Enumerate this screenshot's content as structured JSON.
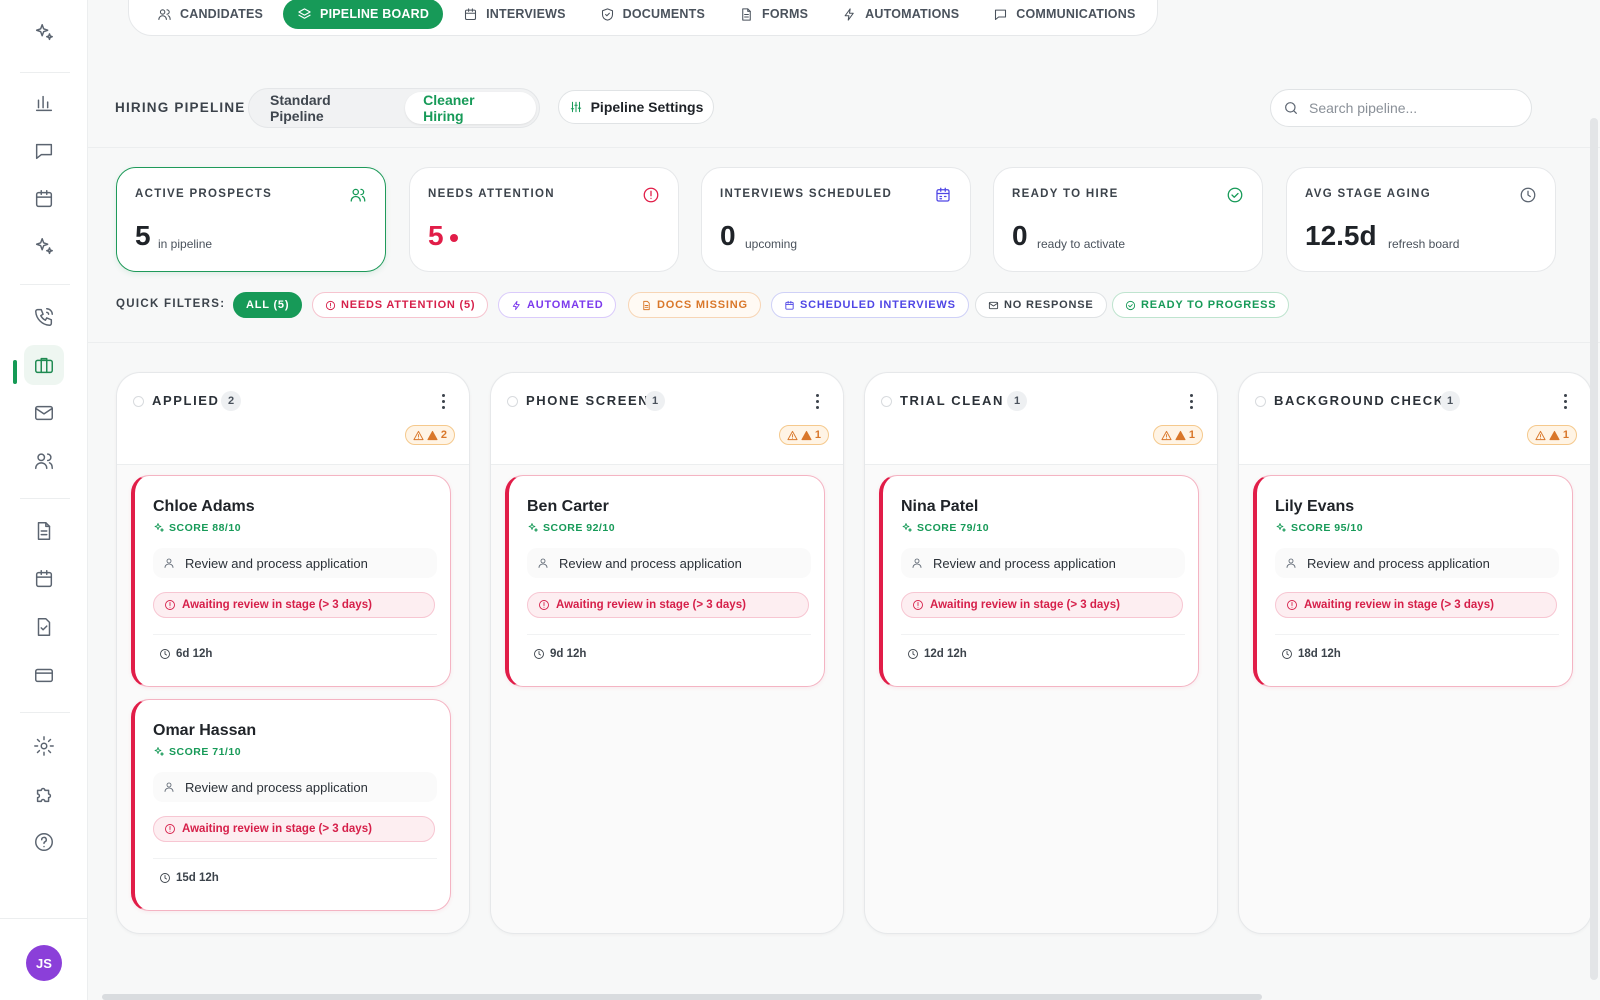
{
  "topnav": {
    "tabs": [
      {
        "label": "CANDIDATES",
        "icon": "users-icon"
      },
      {
        "label": "PIPELINE BOARD",
        "icon": "layers-icon",
        "active": true
      },
      {
        "label": "INTERVIEWS",
        "icon": "calendar-icon"
      },
      {
        "label": "DOCUMENTS",
        "icon": "shield-icon"
      },
      {
        "label": "FORMS",
        "icon": "file-icon"
      },
      {
        "label": "AUTOMATIONS",
        "icon": "bolt-icon"
      },
      {
        "label": "COMMUNICATIONS",
        "icon": "message-icon"
      }
    ]
  },
  "sidebar": {
    "icons": [
      "sparkle-icon",
      "bar-chart-icon",
      "message-icon",
      "calendar-icon",
      "sparkle-icon",
      "phone-icon",
      "briefcase-icon",
      "mail-icon",
      "users-icon",
      "document-icon",
      "calendar-icon",
      "clipboard-check-icon",
      "credit-card-icon",
      "gear-icon",
      "puzzle-icon",
      "help-icon"
    ],
    "active_icon": "briefcase-icon",
    "avatar_initials": "JS"
  },
  "header": {
    "label": "HIRING PIPELINE",
    "segments": [
      "Standard Pipeline",
      "Cleaner Hiring"
    ],
    "active_segment": "Cleaner Hiring",
    "settings_label": "Pipeline Settings",
    "search_placeholder": "Search pipeline..."
  },
  "stats": [
    {
      "label": "ACTIVE PROSPECTS",
      "value": "5",
      "sub": "in pipeline",
      "icon": "users-icon",
      "icon_color": "#179a58"
    },
    {
      "label": "NEEDS ATTENTION",
      "value": "5",
      "sub": "",
      "icon": "alert-circle-icon",
      "icon_color": "#e11d48"
    },
    {
      "label": "INTERVIEWS SCHEDULED",
      "value": "0",
      "sub": "upcoming",
      "icon": "calendar-icon",
      "icon_color": "#4f46e5"
    },
    {
      "label": "READY TO HIRE",
      "value": "0",
      "sub": "ready to activate",
      "icon": "check-circle-icon",
      "icon_color": "#179a58"
    },
    {
      "label": "AVG STAGE AGING",
      "value": "12.5d",
      "sub": "refresh board",
      "icon": "clock-icon",
      "icon_color": "#5b6470"
    }
  ],
  "quick_filters": {
    "label": "QUICK FILTERS:",
    "chips": [
      {
        "label": "ALL (5)",
        "style": "all"
      },
      {
        "label": "NEEDS ATTENTION (5)",
        "style": "red",
        "icon": "alert-circle-icon"
      },
      {
        "label": "AUTOMATED",
        "style": "purple",
        "icon": "bolt-icon"
      },
      {
        "label": "DOCS MISSING",
        "style": "orange",
        "icon": "file-icon"
      },
      {
        "label": "SCHEDULED INTERVIEWS",
        "style": "indigo",
        "icon": "calendar-icon"
      },
      {
        "label": "NO RESPONSE",
        "style": "gray",
        "icon": "mail-icon"
      },
      {
        "label": "READY TO PROGRESS",
        "style": "green",
        "icon": "check-circle-icon"
      }
    ]
  },
  "columns": [
    {
      "title": "APPLIED",
      "count": "2",
      "warning": "2",
      "cards": [
        {
          "name": "Chloe Adams",
          "score": "SCORE 88/10",
          "task": "Review and process application",
          "alert": "Awaiting review in stage (> 3 days)",
          "time": "6d 12h"
        },
        {
          "name": "Omar Hassan",
          "score": "SCORE 71/10",
          "task": "Review and process application",
          "alert": "Awaiting review in stage (> 3 days)",
          "time": "15d 12h"
        }
      ]
    },
    {
      "title": "PHONE SCREEN",
      "count": "1",
      "warning": "1",
      "cards": [
        {
          "name": "Ben Carter",
          "score": "SCORE 92/10",
          "task": "Review and process application",
          "alert": "Awaiting review in stage (> 3 days)",
          "time": "9d 12h"
        }
      ]
    },
    {
      "title": "TRIAL CLEAN",
      "count": "1",
      "warning": "1",
      "cards": [
        {
          "name": "Nina Patel",
          "score": "SCORE 79/10",
          "task": "Review and process application",
          "alert": "Awaiting review in stage (> 3 days)",
          "time": "12d 12h"
        }
      ]
    },
    {
      "title": "BACKGROUND CHECK",
      "count": "1",
      "warning": "1",
      "cards": [
        {
          "name": "Lily Evans",
          "score": "SCORE 95/10",
          "task": "Review and process application",
          "alert": "Awaiting review in stage (> 3 days)",
          "time": "18d 12h"
        }
      ]
    }
  ]
}
